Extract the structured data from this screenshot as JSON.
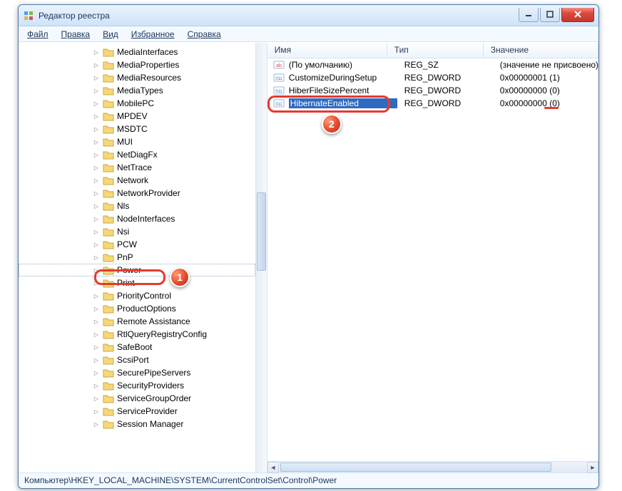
{
  "window": {
    "title": "Редактор реестра"
  },
  "menubar": {
    "items": [
      "Файл",
      "Правка",
      "Вид",
      "Избранное",
      "Справка"
    ]
  },
  "tree": {
    "items": [
      "MediaInterfaces",
      "MediaProperties",
      "MediaResources",
      "MediaTypes",
      "MobilePC",
      "MPDEV",
      "MSDTC",
      "MUI",
      "NetDiagFx",
      "NetTrace",
      "Network",
      "NetworkProvider",
      "Nls",
      "NodeInterfaces",
      "Nsi",
      "PCW",
      "PnP",
      "Power",
      "Print",
      "PriorityControl",
      "ProductOptions",
      "Remote Assistance",
      "RtlQueryRegistryConfig",
      "SafeBoot",
      "ScsiPort",
      "SecurePipeServers",
      "SecurityProviders",
      "ServiceGroupOrder",
      "ServiceProvider",
      "Session Manager"
    ],
    "selected_index": 17
  },
  "list": {
    "headers": {
      "name": "Имя",
      "type": "Тип",
      "value": "Значение"
    },
    "rows": [
      {
        "icon": "string",
        "name": "(По умолчанию)",
        "type": "REG_SZ",
        "value": "(значение не присвоено)"
      },
      {
        "icon": "dword",
        "name": "CustomizeDuringSetup",
        "type": "REG_DWORD",
        "value": "0x00000001 (1)"
      },
      {
        "icon": "dword",
        "name": "HiberFileSizePercent",
        "type": "REG_DWORD",
        "value": "0x00000000 (0)"
      },
      {
        "icon": "dword",
        "name": "HibernateEnabled",
        "type": "REG_DWORD",
        "value": "0x00000000 (0)"
      }
    ],
    "selected_index": 3
  },
  "statusbar": {
    "path": "Компьютер\\HKEY_LOCAL_MACHINE\\SYSTEM\\CurrentControlSet\\Control\\Power"
  },
  "annotations": {
    "badge1": "1",
    "badge2": "2"
  }
}
